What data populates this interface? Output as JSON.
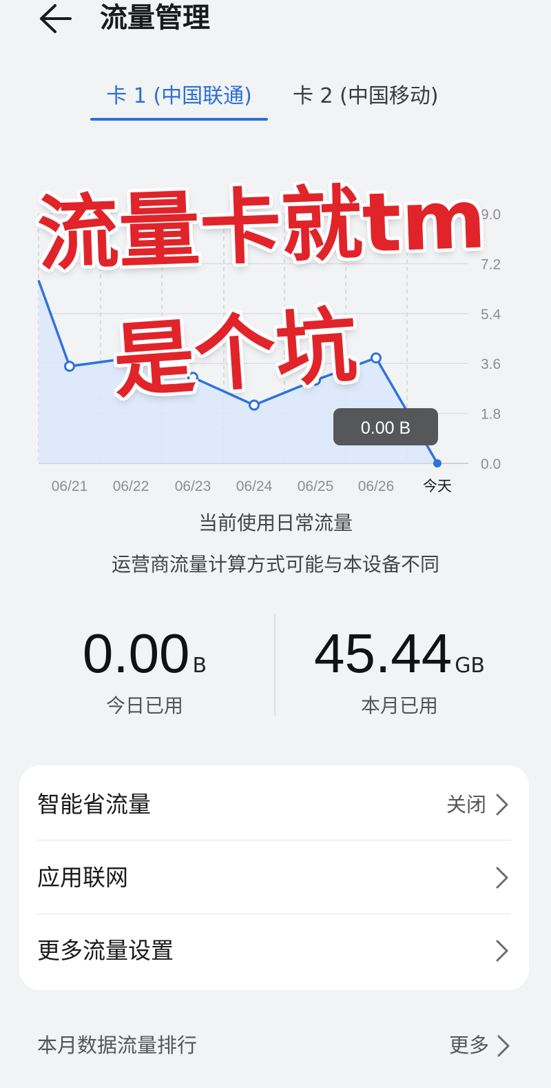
{
  "header": {
    "title": "流量管理",
    "back_icon": "arrow-left-icon"
  },
  "tabs": [
    {
      "label": "卡 1 (中国联通)",
      "active": true
    },
    {
      "label": "卡 2 (中国移动)",
      "active": false
    }
  ],
  "chart_data": {
    "type": "line",
    "categories": [
      "06/21",
      "06/22",
      "06/23",
      "06/24",
      "06/25",
      "06/26",
      "今天"
    ],
    "values": [
      3.5,
      3.8,
      3.1,
      2.1,
      3.0,
      3.8,
      0.0
    ],
    "start_value": 6.6,
    "y_ticks": [
      "9.0",
      "7.2",
      "5.4",
      "3.6",
      "1.8",
      "0.0"
    ],
    "ylim": [
      0,
      9.0
    ],
    "tooltip": "0.00 B",
    "line_color": "#2f72dc",
    "fill_color": "#dbe7fb",
    "grid": true,
    "title": "",
    "xlabel": "",
    "ylabel": ""
  },
  "notes": {
    "line1": "当前使用日常流量",
    "line2": "运营商流量计算方式可能与本设备不同"
  },
  "stats": {
    "today": {
      "value": "0.00",
      "unit": "B",
      "label": "今日已用"
    },
    "month": {
      "value": "45.44",
      "unit": "GB",
      "label": "本月已用"
    }
  },
  "settings": [
    {
      "label": "智能省流量",
      "value": "关闭"
    },
    {
      "label": "应用联网",
      "value": ""
    },
    {
      "label": "更多流量设置",
      "value": ""
    }
  ],
  "ranking": {
    "label": "本月数据流量排行",
    "more": "更多"
  },
  "overlay": {
    "line1": "流量卡就tm",
    "line2": "是个坑"
  }
}
